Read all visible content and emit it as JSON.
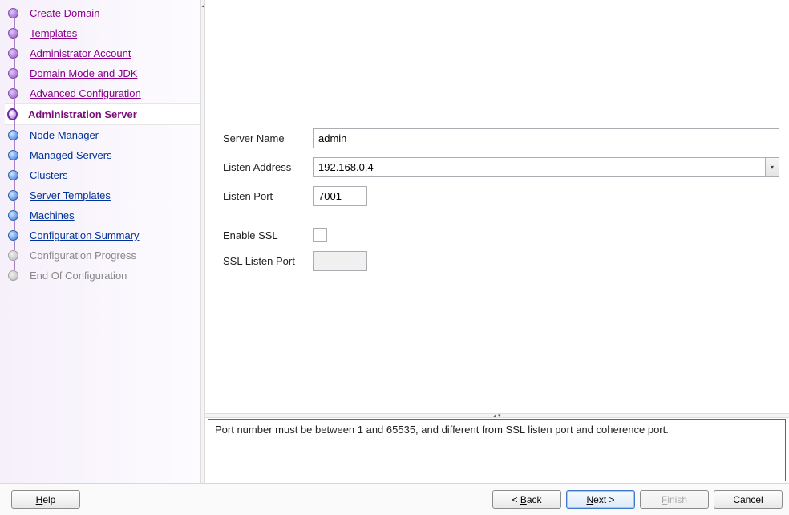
{
  "sidebar": {
    "steps": [
      {
        "label": "Create Domain",
        "state": "done"
      },
      {
        "label": "Templates",
        "state": "done"
      },
      {
        "label": "Administrator Account",
        "state": "done"
      },
      {
        "label": "Domain Mode and JDK",
        "state": "done"
      },
      {
        "label": "Advanced Configuration",
        "state": "done"
      },
      {
        "label": "Administration Server",
        "state": "current"
      },
      {
        "label": "Node Manager",
        "state": "future"
      },
      {
        "label": "Managed Servers",
        "state": "future"
      },
      {
        "label": "Clusters",
        "state": "future"
      },
      {
        "label": "Server Templates",
        "state": "future"
      },
      {
        "label": "Machines",
        "state": "future"
      },
      {
        "label": "Configuration Summary",
        "state": "future"
      },
      {
        "label": "Configuration Progress",
        "state": "disabled"
      },
      {
        "label": "End Of Configuration",
        "state": "disabled"
      }
    ]
  },
  "form": {
    "server_name_label": "Server Name",
    "server_name_value": "admin",
    "listen_address_label": "Listen Address",
    "listen_address_value": "192.168.0.4",
    "listen_port_label": "Listen Port",
    "listen_port_value": "7001",
    "enable_ssl_label": "Enable SSL",
    "enable_ssl_checked": false,
    "ssl_port_label": "SSL Listen Port",
    "ssl_port_value": ""
  },
  "status": {
    "message": "Port number must be between 1 and 65535, and different from SSL listen port and coherence port."
  },
  "buttons": {
    "help": "Help",
    "back": "Back",
    "next": "Next",
    "finish": "Finish",
    "cancel": "Cancel"
  }
}
